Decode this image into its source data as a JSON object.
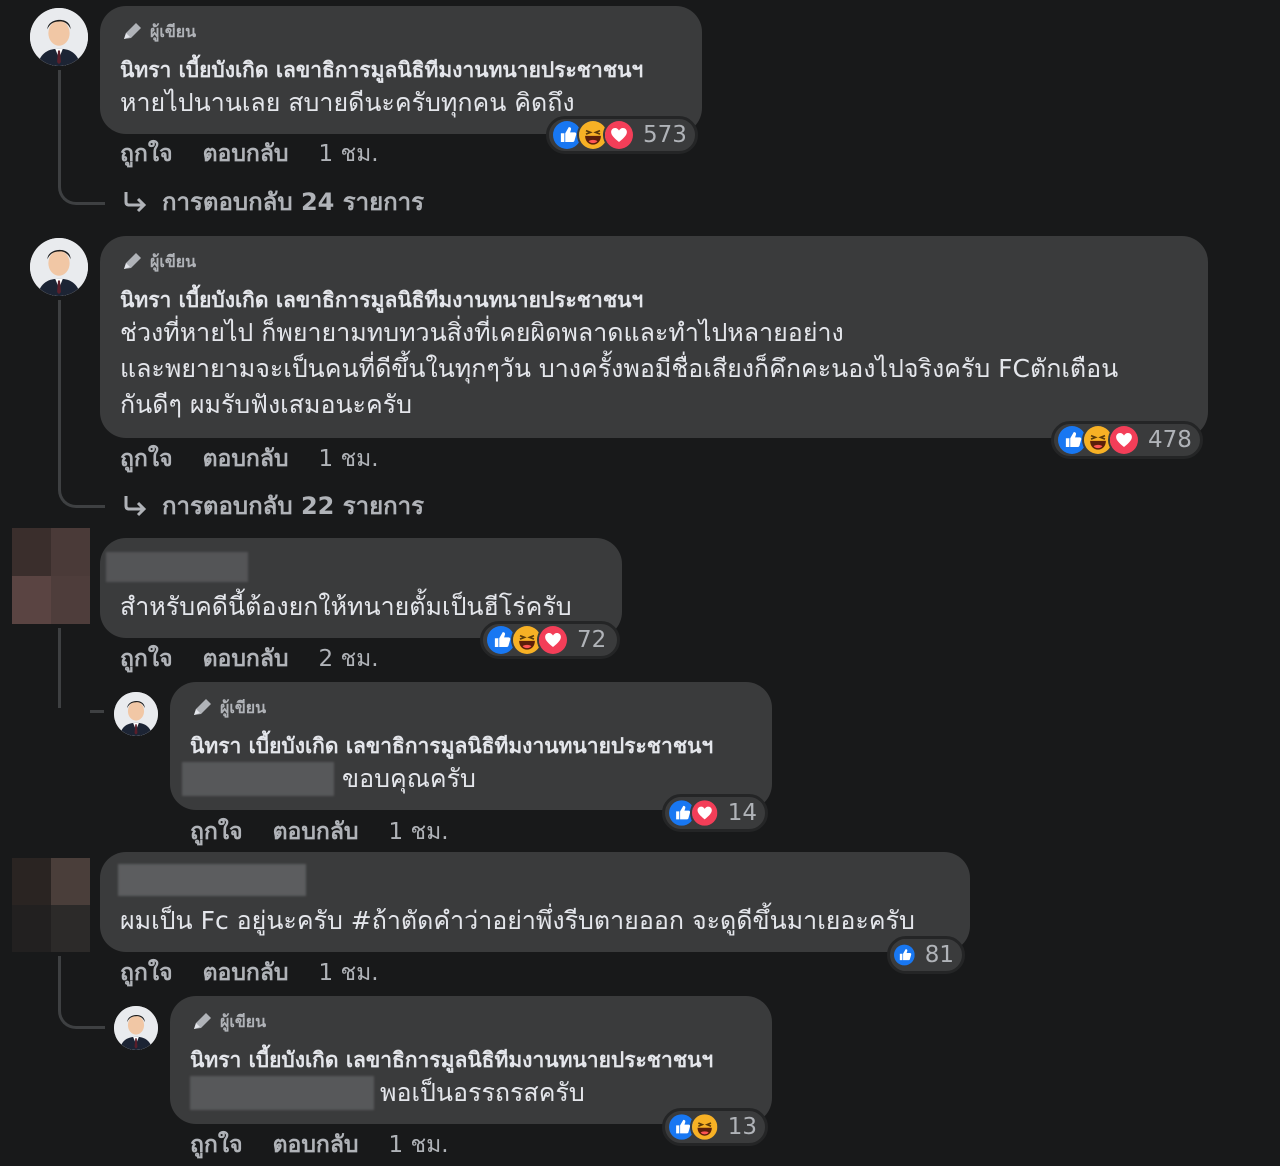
{
  "author_badge": "ผู้เขียน",
  "author_name": "นิทรา เบี้ยบังเกิด เลขาธิการมูลนิธิทีมงานทนายประชาชนฯ",
  "actions": {
    "like": "ถูกใจ",
    "reply": "ตอบกลับ"
  },
  "comments": [
    {
      "lines": [
        "หายไปนานเลย สบายดีนะครับทุกคน คิดถึง"
      ],
      "time": "1 ชม.",
      "reaction_count": "573",
      "replies": "การตอบกลับ 24 รายการ"
    },
    {
      "lines": [
        "ช่วงที่หายไป ก็พยายามทบทวนสิ่งที่เคยผิดพลาดและทำไปหลายอย่าง",
        "และพยายามจะเป็นคนที่ดีขึ้นในทุกๆวัน บางครั้งพอมีชื่อเสียงก็คึกคะนองไปจริงครับ FCตักเตือน",
        "กันดีๆ ผมรับฟังเสมอนะครับ"
      ],
      "time": "1 ชม.",
      "reaction_count": "478",
      "replies": "การตอบกลับ 22 รายการ"
    },
    {
      "lines": [
        "สำหรับคดีนี้ต้องยกให้ทนายตั้มเป็นฮีโร่ครับ"
      ],
      "time": "2 ชม.",
      "reaction_count": "72"
    },
    {
      "lines": [
        "ขอบคุณครับ"
      ],
      "time": "1 ชม.",
      "reaction_count": "14"
    },
    {
      "lines": [
        "ผมเป็น Fc อยู่นะครับ #ถ้าตัดคำว่าอย่าพึ่งรีบตายออก จะดูดีขึ้นมาเยอะครับ"
      ],
      "time": "1 ชม.",
      "reaction_count": "81"
    },
    {
      "lines": [
        "พอเป็นอรรถรสครับ"
      ],
      "time": "1 ชม.",
      "reaction_count": "13"
    }
  ],
  "colors": {
    "background": "#18191a",
    "bubble": "#3a3b3c",
    "like_blue": "#1877f2",
    "love_red": "#f33e58",
    "haha_yellow": "#f7b125"
  }
}
